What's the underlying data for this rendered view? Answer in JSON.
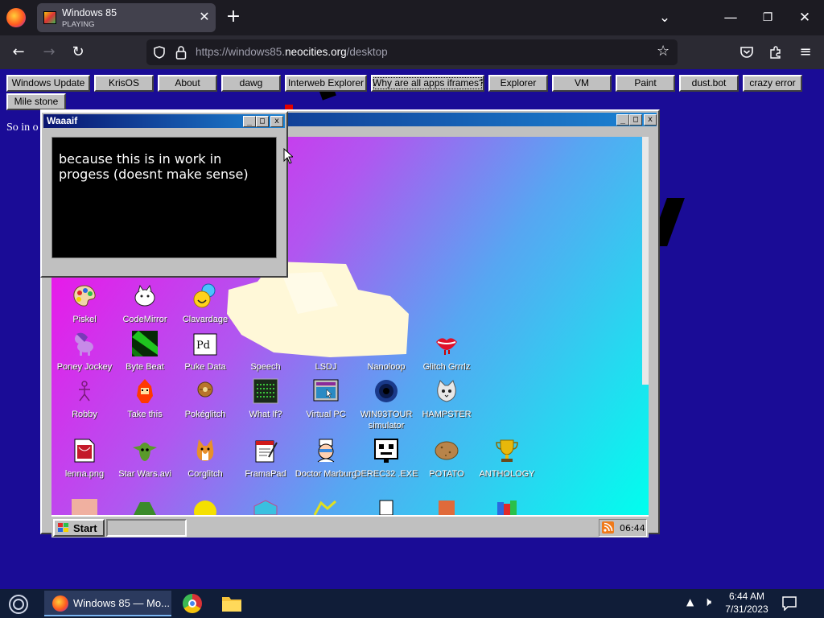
{
  "browser": {
    "tab_title": "Windows 85",
    "tab_subtitle": "PLAYING",
    "url_prefix": "https://windows85.",
    "url_domain": "neocities.org",
    "url_path": "/desktop"
  },
  "app_buttons": [
    "Windows Update",
    "KrisOS",
    "About",
    "dawg",
    "Interweb Explorer",
    "Why are all apps iframes?",
    "Explorer",
    "VM",
    "Paint",
    "dust.bot",
    "crazy error",
    "Mile stone"
  ],
  "page_text": "So in o",
  "popup": {
    "title": "Waaaif",
    "message": "because this is in work in progess (doesnt make sense)"
  },
  "desktop": {
    "icons": [
      {
        "label": "Piskel",
        "icon": "palette-icon"
      },
      {
        "label": "CodeMirror",
        "icon": "cat-icon"
      },
      {
        "label": "Clavardage",
        "icon": "chat-icon"
      },
      {
        "label": "Poney Jockey",
        "icon": "pony-icon"
      },
      {
        "label": "Byte Beat",
        "icon": "bytebeat-icon"
      },
      {
        "label": "Puke Data",
        "icon": "pd-icon"
      },
      {
        "label": "Speech",
        "icon": "speech-icon"
      },
      {
        "label": "LSDJ",
        "icon": "lsdj-icon"
      },
      {
        "label": "Nanoloop",
        "icon": "nanoloop-icon"
      },
      {
        "label": "Glitch Grrrlz",
        "icon": "lips-icon"
      },
      {
        "label": "Robby",
        "icon": "robby-icon"
      },
      {
        "label": "Take this",
        "icon": "fire-character-icon"
      },
      {
        "label": "Pokéglitch",
        "icon": "pokeglitch-icon"
      },
      {
        "label": "What If?",
        "icon": "terminal-icon"
      },
      {
        "label": "Virtual PC",
        "icon": "virtual-pc-icon"
      },
      {
        "label": "WIN93TOUR simulator",
        "icon": "vortex-icon"
      },
      {
        "label": "HAMPSTER",
        "icon": "cat-face-icon"
      },
      {
        "label": "lenna.png",
        "icon": "image-file-icon"
      },
      {
        "label": "Star Wars.avi",
        "icon": "yoda-icon"
      },
      {
        "label": "Corglitch",
        "icon": "corgi-icon"
      },
      {
        "label": "FramaPad",
        "icon": "notepad-icon"
      },
      {
        "label": "Doctor Marburg",
        "icon": "doctor-icon"
      },
      {
        "label": "DEREC32 .EXE",
        "icon": "robot-face-icon"
      },
      {
        "label": "POTATO",
        "icon": "potato-icon"
      },
      {
        "label": "ANTHOLOGY",
        "icon": "trophy-icon"
      }
    ],
    "start_label": "Start",
    "clock": "06:44"
  },
  "taskbar": {
    "app_label": "Windows 85 — Mo...",
    "time": "6:44 AM",
    "date": "7/31/2023"
  },
  "colors": {
    "page_bg": "#1a0c96",
    "title_bar": "#0a1470",
    "win_gray": "#c0c0c0"
  }
}
